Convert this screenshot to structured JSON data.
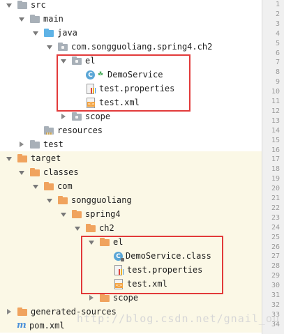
{
  "tree": [
    {
      "label": "src",
      "icon": "folder-gray",
      "state": "open"
    },
    {
      "label": "main",
      "icon": "folder-gray",
      "state": "open"
    },
    {
      "label": "java",
      "icon": "folder-blue",
      "state": "open"
    },
    {
      "label": "com.songguoliang.spring4.ch2",
      "icon": "folder-package",
      "state": "open"
    },
    {
      "label": "el",
      "icon": "folder-package",
      "state": "open"
    },
    {
      "label": "DemoService",
      "icon": "class-icon",
      "state": "none"
    },
    {
      "label": "test.properties",
      "icon": "properties-file-icon",
      "state": "none"
    },
    {
      "label": "test.xml",
      "icon": "xml-file-icon",
      "state": "none"
    },
    {
      "label": "scope",
      "icon": "folder-package",
      "state": "closed"
    },
    {
      "label": "resources",
      "icon": "folder-resources",
      "state": "none"
    },
    {
      "label": "test",
      "icon": "folder-gray",
      "state": "closed"
    },
    {
      "label": "target",
      "icon": "folder-orange",
      "state": "open"
    },
    {
      "label": "classes",
      "icon": "folder-orange",
      "state": "open"
    },
    {
      "label": "com",
      "icon": "folder-orange",
      "state": "open"
    },
    {
      "label": "songguoliang",
      "icon": "folder-orange",
      "state": "open"
    },
    {
      "label": "spring4",
      "icon": "folder-orange",
      "state": "open"
    },
    {
      "label": "ch2",
      "icon": "folder-orange",
      "state": "open"
    },
    {
      "label": "el",
      "icon": "folder-orange",
      "state": "open"
    },
    {
      "label": "DemoService.class",
      "icon": "compiled-class-icon",
      "state": "none"
    },
    {
      "label": "test.properties",
      "icon": "properties-file-icon",
      "state": "none"
    },
    {
      "label": "test.xml",
      "icon": "xml-file-icon",
      "state": "none"
    },
    {
      "label": "scope",
      "icon": "folder-orange",
      "state": "closed"
    },
    {
      "label": "generated-sources",
      "icon": "folder-orange",
      "state": "closed"
    },
    {
      "label": "pom.xml",
      "icon": "maven-icon",
      "state": "none"
    }
  ],
  "gutter": [
    "1",
    "2",
    "3",
    "4",
    "5",
    "6",
    "7",
    "8",
    "9",
    "10",
    "11",
    "12",
    "13",
    "14",
    "15",
    "16",
    "17",
    "18",
    "19",
    "20",
    "21",
    "22",
    "23",
    "24",
    "25",
    "26",
    "27",
    "28",
    "29",
    "30",
    "31",
    "32",
    "33",
    "34"
  ],
  "watermark": "http://blog.csdn.net/gnail_ou",
  "colors": {
    "highlight": "#e23a3a",
    "target_bg": "#fbf8e6"
  }
}
